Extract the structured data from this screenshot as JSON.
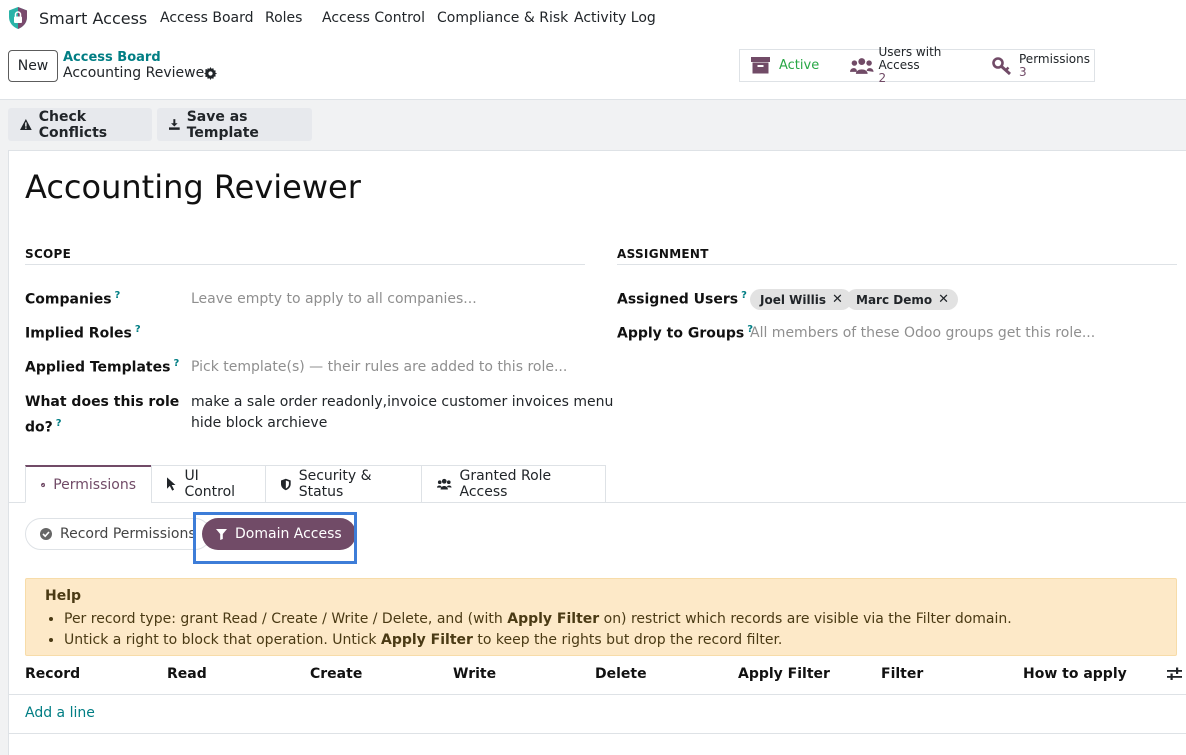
{
  "navbar": {
    "app_name": "Smart Access",
    "menu": [
      "Access Board",
      "Roles",
      "Access Control",
      "Compliance & Risk",
      "Activity Log"
    ]
  },
  "control_panel": {
    "new_label": "New",
    "breadcrumb_parent": "Access Board",
    "breadcrumb_current": "Accounting Reviewer",
    "stats": {
      "active_label": "Active",
      "users_label": "Users with Access",
      "users_count": "2",
      "perms_label": "Permissions",
      "perms_count": "3"
    }
  },
  "actions": {
    "check_conflicts": "Check Conflicts",
    "save_template": "Save as Template"
  },
  "record": {
    "title": "Accounting Reviewer",
    "scope": {
      "heading": "SCOPE",
      "companies_label": "Companies",
      "companies_placeholder": "Leave empty to apply to all companies...",
      "implied_roles_label": "Implied Roles",
      "templates_label": "Applied Templates",
      "templates_placeholder": "Pick template(s) — their rules are added to this role...",
      "what_label_1": "What does this role",
      "what_label_2": "do?",
      "what_value_1": "make a sale order readonly,invoice customer invoices menu",
      "what_value_2": "hide block archieve",
      "help_mark": "?"
    },
    "assignment": {
      "heading": "ASSIGNMENT",
      "users_label": "Assigned Users",
      "users": [
        "Joel Willis",
        "Marc Demo"
      ],
      "groups_label": "Apply to Groups",
      "groups_placeholder": "All members of these Odoo groups get this role..."
    }
  },
  "tabs": [
    "Permissions",
    "UI Control",
    "Security & Status",
    "Granted Role Access"
  ],
  "subtabs": {
    "record_permissions": "Record Permissions",
    "domain_access": "Domain Access"
  },
  "help": {
    "title": "Help",
    "line1_a": "Per record type: grant Read / Create / Write / Delete, and (with ",
    "line1_b": "Apply Filter",
    "line1_c": " on) restrict which records are visible via the Filter domain.",
    "line2_a": "Untick a right to block that operation. Untick ",
    "line2_b": "Apply Filter",
    "line2_c": " to keep the rights but drop the record filter."
  },
  "table": {
    "columns": [
      "Record",
      "Read",
      "Create",
      "Write",
      "Delete",
      "Apply Filter",
      "Filter",
      "How to apply"
    ],
    "add_line": "Add a line"
  },
  "colors": {
    "brand": "#714b67",
    "link": "#017e84",
    "active_green": "#28a745",
    "highlight_box": "#3d7dd8"
  }
}
